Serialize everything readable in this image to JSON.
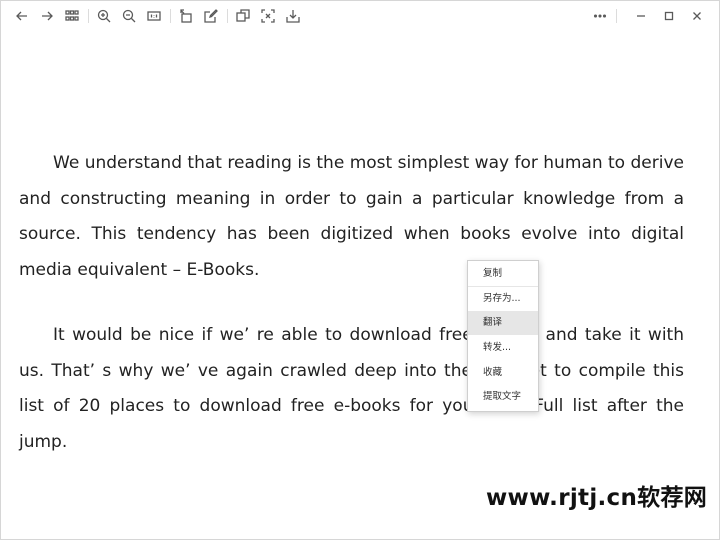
{
  "toolbar": {
    "left_icons": [
      "back-arrow-icon",
      "forward-arrow-icon",
      "grid-view-icon",
      "zoom-in-icon",
      "zoom-out-icon",
      "actual-size-icon",
      "rotate-icon",
      "edit-icon",
      "copy-frame-icon",
      "scan-text-icon",
      "download-icon"
    ],
    "right_icons": [
      "more-icon",
      "minimize-icon",
      "maximize-icon",
      "close-icon"
    ]
  },
  "document": {
    "paragraph1": "We understand that reading is the most simplest way for human to derive and constructing meaning in order to gain a particular knowledge from a source. This tendency has been digitized when books evolve into digital media equivalent – E-Books.",
    "paragraph2": "It would be nice if we’ re able to download free e-book and take it with us. That’ s why we’ ve again crawled deep into the Internet to compile this list of 20 places to download free e-books for your use. Full list after the jump."
  },
  "context_menu": {
    "items": [
      "复制",
      "另存为...",
      "翻译",
      "转发...",
      "收藏",
      "提取文字"
    ],
    "highlighted_index": 2
  },
  "watermark": {
    "text": "www.rjtj.cn软荐网"
  },
  "colors": {
    "menu_highlight": "#e6e6e6",
    "text": "#222222",
    "window_border": "#d6d6d6"
  }
}
